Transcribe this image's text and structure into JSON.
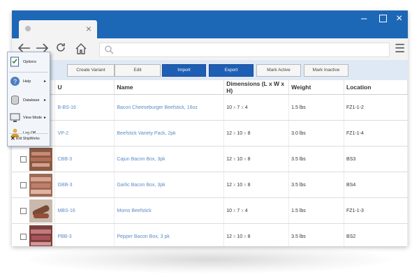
{
  "browser": {
    "tab_close": "×",
    "controls": {
      "minimize": "–",
      "close": "×"
    },
    "nav_icons": [
      "arrow-left-icon",
      "arrow-right-icon",
      "reload-icon",
      "home-icon"
    ],
    "address_value": "",
    "menu_glyph": "☰"
  },
  "actions": {
    "create_variant": "Create Variant",
    "edit": "Edit",
    "import": "Import",
    "export": "Export",
    "mark_active": "Mark Active",
    "mark_inactive": "Mark Inactive"
  },
  "table": {
    "columns": [
      "U",
      "Name",
      "Dimensions (L x W x H)",
      "Weight",
      "Location"
    ],
    "rows": [
      {
        "sku": "B-BS-16",
        "name": "Bacon Cheeseburger Beefstick, 16oz",
        "l": "10",
        "w": "7",
        "h": "4",
        "weight": "1.5 lbs",
        "location": "FZ1-1-2"
      },
      {
        "sku": "VP-2",
        "name": "Beefstick Variety Pack, 2pk",
        "l": "12",
        "w": "10",
        "h": "8",
        "weight": "3.0 lbs",
        "location": "FZ1-1-4"
      },
      {
        "sku": "CBB-3",
        "name": "Cajun Bacon Box, 3pk",
        "l": "12",
        "w": "10",
        "h": "8",
        "weight": "3.5 lbs",
        "location": "BS3"
      },
      {
        "sku": "GBB-3",
        "name": "Garlic Bacon Box, 3pk",
        "l": "12",
        "w": "10",
        "h": "8",
        "weight": "3.5 lbs",
        "location": "BS4"
      },
      {
        "sku": "MBS-16",
        "name": "Moms Beefstick",
        "l": "10",
        "w": "7",
        "h": "4",
        "weight": "1.5 lbs",
        "location": "FZ1-1-3"
      },
      {
        "sku": "PBB-3",
        "name": "Pepper Bacon Box, 3 pk",
        "l": "12",
        "w": "10",
        "h": "8",
        "weight": "3.5 lbs",
        "location": "BS2"
      }
    ],
    "dim_sep": "x"
  },
  "side_menu": {
    "items": [
      {
        "label": "Options",
        "icon": "checklist-icon",
        "has_submenu": false
      },
      {
        "label": "Help",
        "icon": "help-icon",
        "has_submenu": true
      },
      {
        "label": "Database",
        "icon": "database-icon",
        "has_submenu": true
      },
      {
        "label": "View Mode",
        "icon": "monitor-icon",
        "has_submenu": true
      },
      {
        "label": "Log Off",
        "icon": "user-icon",
        "has_submenu": false
      }
    ],
    "submenu_arrow": "▸",
    "exit_label": "Exit ShipWorks",
    "exit_glyph": "✕"
  },
  "colors": {
    "window_frame": "#1c67b6",
    "primary_button": "#1e5fb5",
    "link_text": "#5d8bc6",
    "action_bar": "#dfe9f6"
  }
}
